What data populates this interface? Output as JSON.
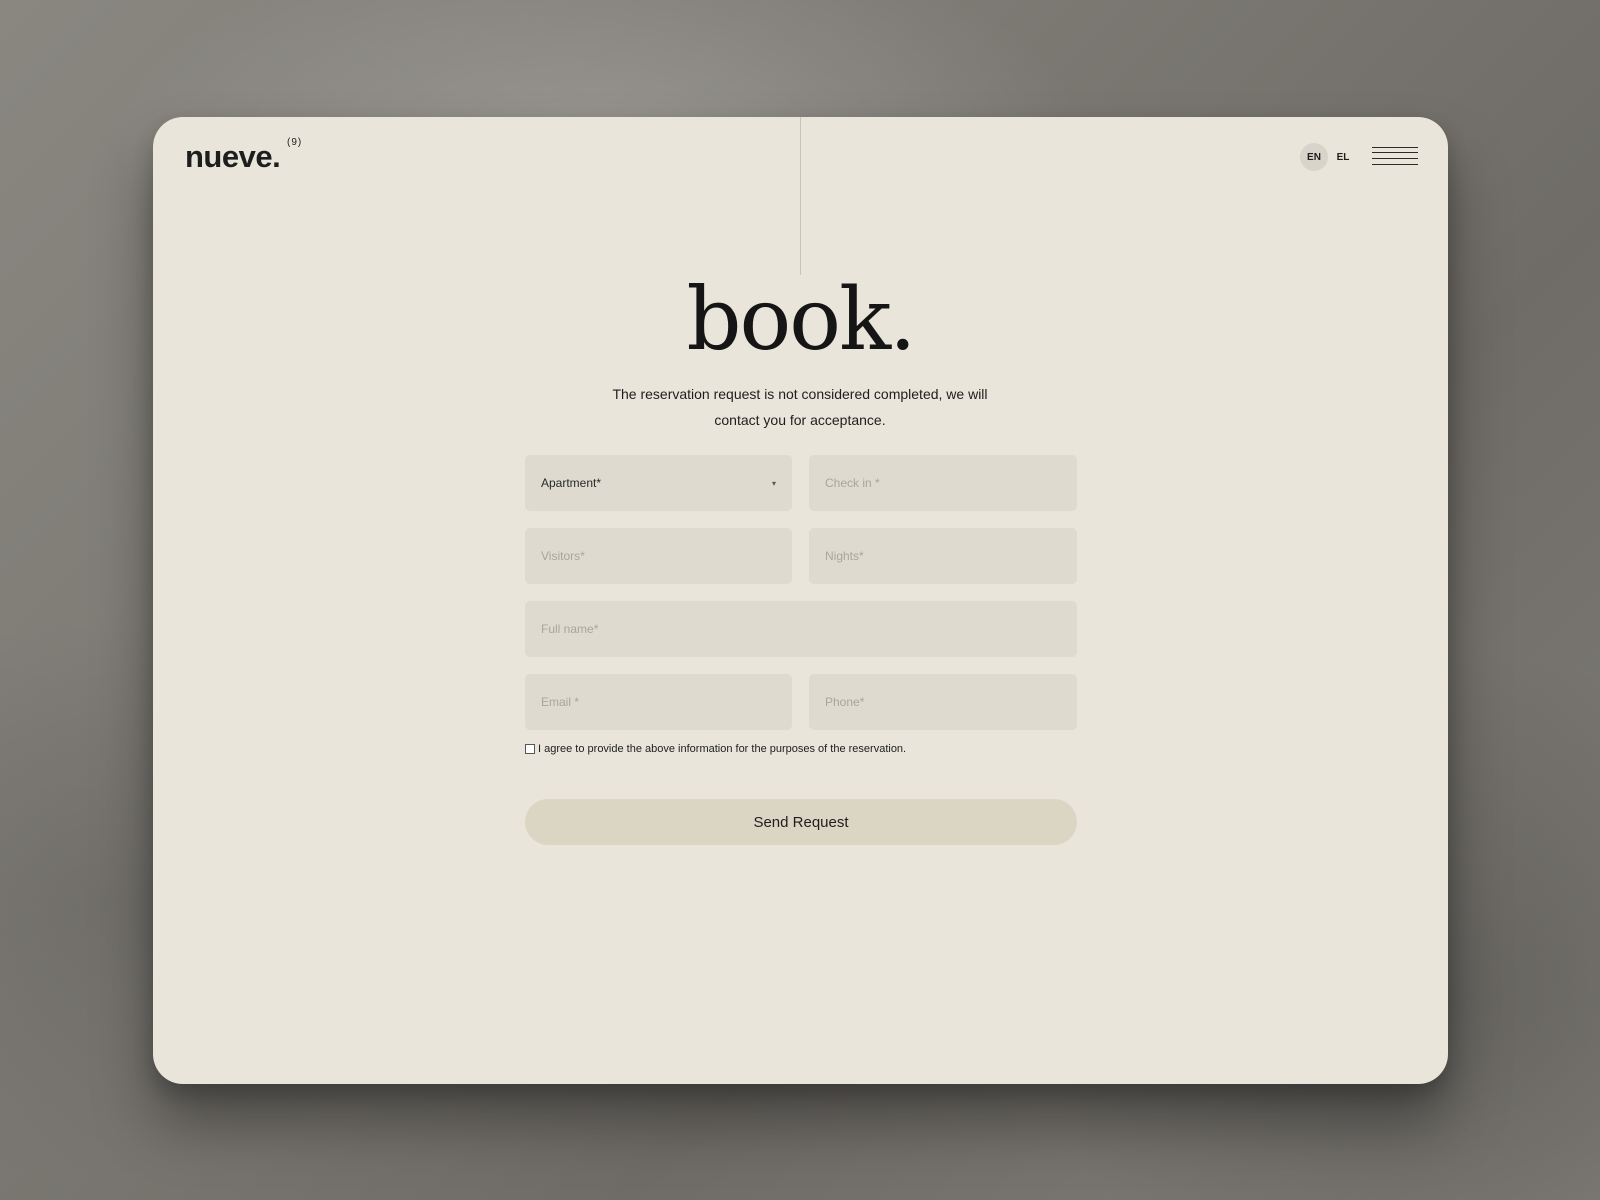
{
  "header": {
    "logo": "nueve.",
    "logo_sup": "(9)",
    "languages": [
      "EN",
      "EL"
    ],
    "active_language": "EN"
  },
  "hero": {
    "title": "book.",
    "subtitle": "The reservation request is not considered completed, we will contact you for acceptance."
  },
  "form": {
    "apartment_label": "Apartment*",
    "checkin_placeholder": "Check in *",
    "visitors_placeholder": "Visitors*",
    "nights_placeholder": "Nights*",
    "fullname_placeholder": "Full name*",
    "email_placeholder": "Email *",
    "phone_placeholder": "Phone*",
    "consent_text": "I agree to provide the above information for the purposes of the reservation.",
    "submit_label": "Send Request"
  },
  "colors": {
    "card_bg": "#e9e5da",
    "field_bg": "#dedad0",
    "button_bg": "#dbd5c3",
    "text": "#1e1e1e"
  }
}
